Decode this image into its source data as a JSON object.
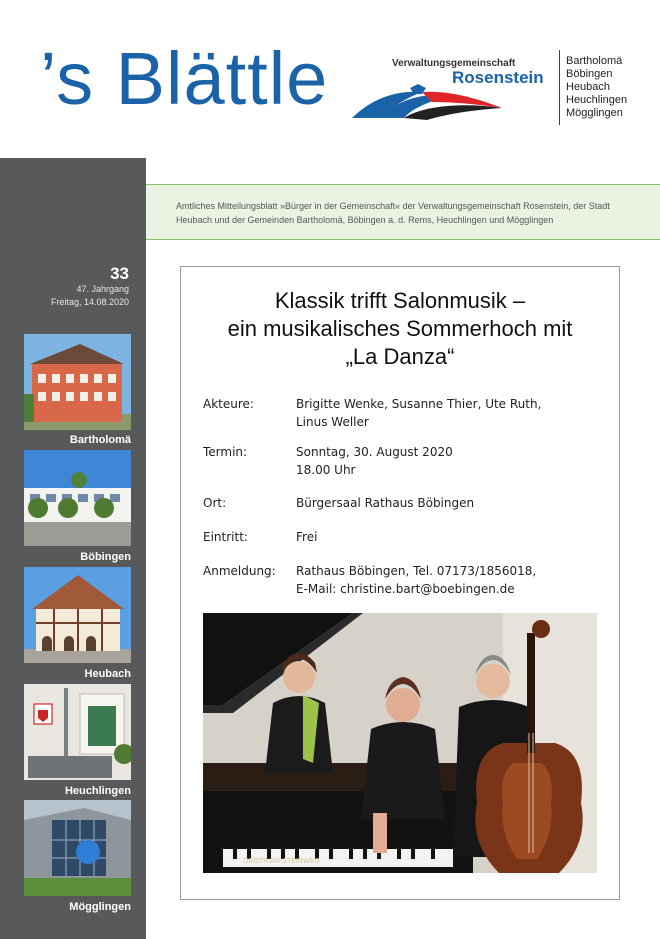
{
  "masthead": {
    "title": "’s Blättle",
    "vg_label": "Verwaltungsgemeinschaft",
    "vg_name": "Rosenstein",
    "towns": [
      "Bartholomä",
      "Böbingen",
      "Heubach",
      "Heuchlingen",
      "Mögglingen"
    ]
  },
  "band": {
    "text": "Amtliches Mitteilungsblatt »Bürger in der Gemeinschaft« der Verwaltungsgemeinschaft Rosenstein, der Stadt Heubach und der Gemeinden Bartholomä, Böbingen a. d. Rems, Heuchlingen und Mögglingen"
  },
  "issue": {
    "number": "33",
    "year": "47. Jahrgang",
    "date": "Freitag, 14.08.2020"
  },
  "sidebar": {
    "thumbs": [
      "Bartholomä",
      "Böbingen",
      "Heubach",
      "Heuchlingen",
      "Mögglingen"
    ]
  },
  "flyer": {
    "title_lines": [
      "Klassik trifft Salonmusik –",
      "ein musikalisches Sommerhoch mit",
      "„La Danza“"
    ],
    "rows": [
      {
        "label": "Akteure:",
        "value_lines": [
          "Brigitte Wenke, Susanne Thier, Ute Ruth,",
          "Linus Weller"
        ]
      },
      {
        "label": "Termin:",
        "value_lines": [
          "Sonntag, 30. August 2020",
          "18.00 Uhr"
        ]
      },
      {
        "label": "Ort:",
        "value_lines": [
          "Bürgersaal Rathaus Böbingen"
        ]
      },
      {
        "label": "Eintritt:",
        "value_lines": [
          "Frei"
        ]
      },
      {
        "label": "Anmeldung:",
        "value_lines": [
          "Rathaus Böbingen, Tel. 07173/1856018,",
          "E-Mail: christine.bart@boebingen.de"
        ]
      }
    ],
    "piano_brand": "GROTRIAN-STEINWEG"
  },
  "colors": {
    "brand_blue": "#1b63a8",
    "logo_red": "#e2242b",
    "sidebar_gray": "#58595b",
    "band_green": "#eaf3e1"
  }
}
